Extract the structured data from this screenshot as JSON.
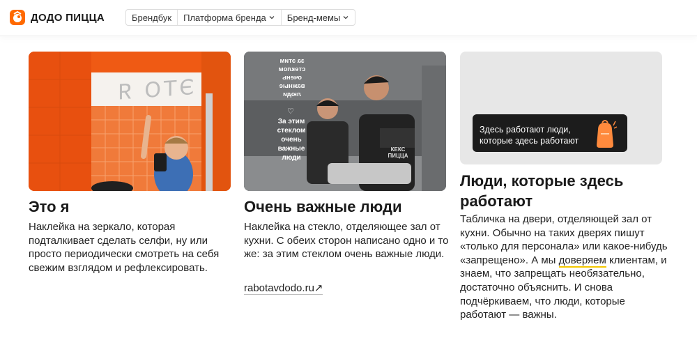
{
  "header": {
    "brand": "ДОДО ПИЦЦА",
    "nav": [
      {
        "label": "Брендбук"
      },
      {
        "label": "Платформа бренда"
      },
      {
        "label": "Бренд-мемы"
      }
    ]
  },
  "cards": [
    {
      "image_text": "ЭТО Я",
      "title": "Это я",
      "text": "Наклейка на зеркало, которая подталкивает сделать селфи, ну или просто периодически смотреть на себя свежим взглядом и рефлексировать."
    },
    {
      "glass_text_mirrored": "за этим стеклом очень важные люди",
      "glass_text": "За этим стеклом очень важные люди",
      "apron_text": "КЕКС ПИЦЦА",
      "title": "Очень важные люди",
      "text": "Наклейка на стекло, отделяющее зал от кухни. С обеих сторон написано одно и то же: за этим стеклом очень важные люди.",
      "link": "rabotavdodo.ru↗"
    },
    {
      "sign_text": "Здесь работают люди, которые здесь работают",
      "title": "Люди, которые здесь работают",
      "text_part1": "Табличка на двери, отделяющей зал от кухни. Обычно на таких дверях пишут «только для персонала» или какое-нибудь «запрещено». А мы ",
      "text_highlight": "доверяем",
      "text_part2": " клиентам, и знаем, что запрещать необязательно, достаточно объяснить. И снова подчёркиваем, что люди, которые работают — важны."
    }
  ],
  "colors": {
    "brand_orange": "#ff6900",
    "wall_orange": "#ef5a14",
    "highlight": "#f4c800"
  }
}
